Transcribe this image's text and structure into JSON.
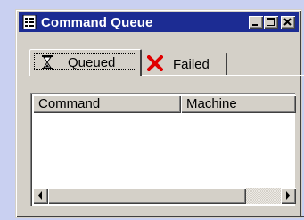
{
  "window": {
    "title": "Command Queue",
    "app_icon": "list-icon",
    "title_bar_color": "#1c2c93",
    "buttons": [
      "minimize-icon",
      "maximize-icon",
      "close-icon"
    ]
  },
  "tabs": [
    {
      "label": "Queued",
      "icon": "hourglass-icon",
      "selected": true
    },
    {
      "label": "Failed",
      "icon": "red-x-icon",
      "icon_color": "#e00000",
      "selected": false
    }
  ],
  "listview": {
    "columns": [
      "Command",
      "Machine"
    ],
    "rows": []
  },
  "scrollbar": {
    "left_icon": "arrow-left-icon",
    "right_icon": "arrow-right-icon"
  },
  "colors": {
    "desktop": "#c9d0f1",
    "face": "#d4d0c8"
  }
}
